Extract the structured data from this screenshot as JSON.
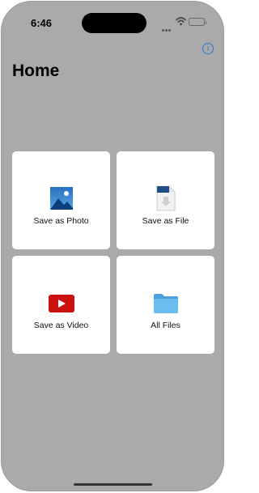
{
  "status_bar": {
    "time": "6:46"
  },
  "header": {
    "title": "Home",
    "info_icon": "info-circle-icon",
    "info_symbol": "i"
  },
  "tiles": [
    {
      "label": "Save as Photo",
      "icon": "photo-icon"
    },
    {
      "label": "Save as File",
      "icon": "document-icon"
    },
    {
      "label": "Save as Video",
      "icon": "youtube-icon"
    },
    {
      "label": "All Files",
      "icon": "folder-icon"
    }
  ],
  "colors": {
    "background": "#aaaaaa",
    "tile": "#ffffff",
    "accent": "#2f78d6",
    "video_red": "#cc1111",
    "folder_blue": "#5fb4ea"
  }
}
